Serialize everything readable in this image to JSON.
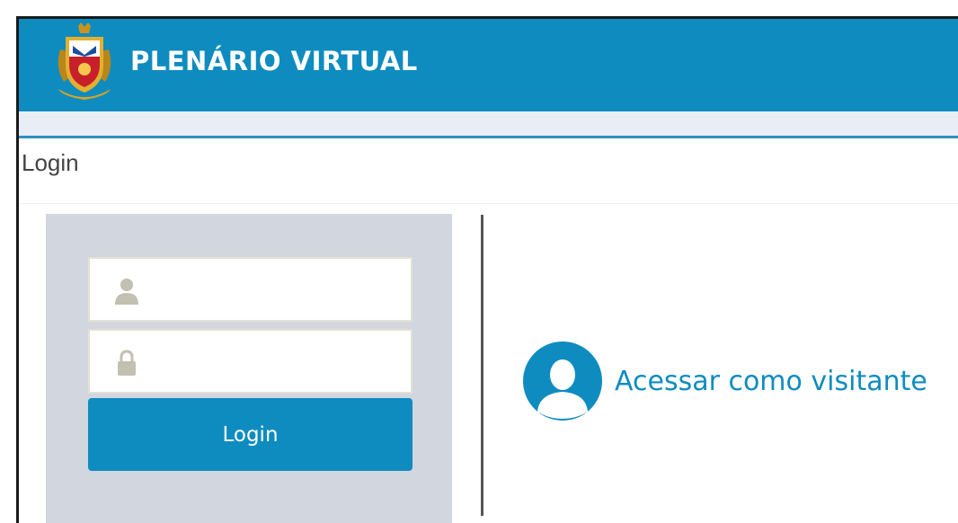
{
  "header": {
    "title": "PLENÁRIO VIRTUAL",
    "logo_icon": "coat-of-arms-icon"
  },
  "breadcrumb": {
    "label": "Login"
  },
  "login_form": {
    "username": {
      "value": "",
      "placeholder": "",
      "icon": "user-icon"
    },
    "password": {
      "value": "",
      "placeholder": "",
      "icon": "lock-icon"
    },
    "submit_label": "Login"
  },
  "visitor": {
    "label": "Acessar como visitante",
    "icon": "user-avatar-icon"
  },
  "colors": {
    "brand": "#0e8cc0",
    "subbar": "#e9eef6",
    "panel": "#d2d6de",
    "input_border": "#e3e1d5",
    "icon_muted": "#c2c0b0"
  }
}
